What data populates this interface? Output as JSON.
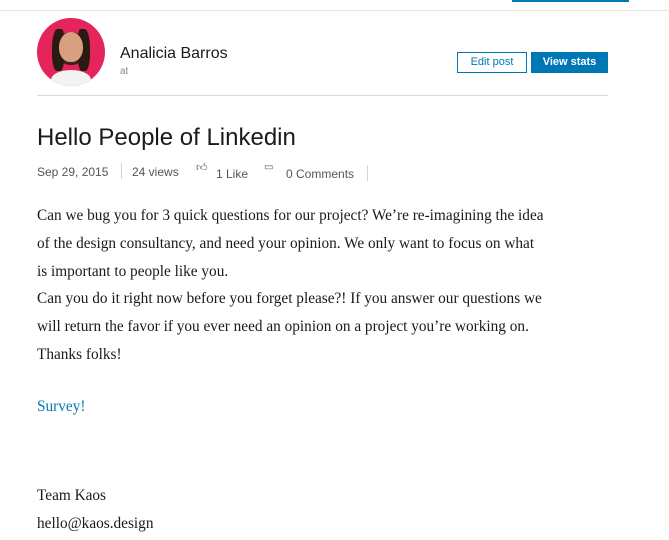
{
  "author": {
    "name": "Analicia Barros",
    "subtitle": "at"
  },
  "actions": {
    "edit_label": "Edit post",
    "stats_label": "View stats"
  },
  "post": {
    "title": "Hello People of Linkedin",
    "date": "Sep 29, 2015",
    "views": "24 views",
    "likes": "1 Like",
    "comments": "0 Comments",
    "body_lines": [
      "Can we bug you for 3 quick questions for our project? We’re re-imagining the idea",
      "of the design consultancy, and need your opinion. We only want to focus on what",
      "is important to people like you.",
      "Can you do it right now before you forget please?! If you answer our questions we",
      "will return the favor if you ever need an opinion on a project you’re working on.",
      "Thanks folks!"
    ],
    "link_text": "Survey!",
    "signature_name": "Team Kaos",
    "signature_email": "hello@kaos.design"
  },
  "icons": {
    "like": "thumbs-up-icon",
    "comment": "comment-icon"
  },
  "colors": {
    "accent": "#0077b5",
    "avatar_background": "#e5245c"
  }
}
